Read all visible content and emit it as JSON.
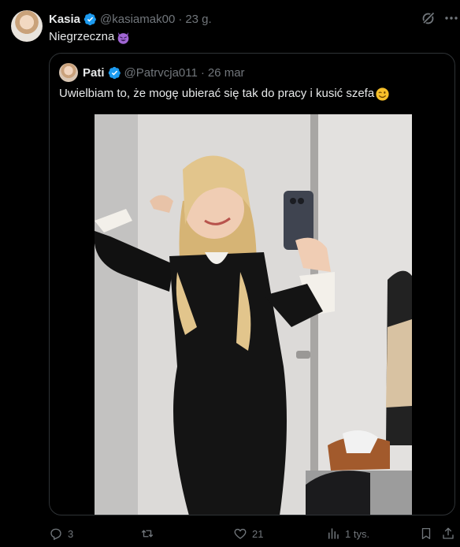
{
  "tweet": {
    "author_name": "Kasia",
    "author_handle": "@kasiamak00",
    "separator": "·",
    "time": "23 g.",
    "text": "Niegrzeczna",
    "text_emoji": "smiling-devil-emoji"
  },
  "quoted": {
    "author_name": "Pati",
    "author_handle": "@Patrvcja011",
    "separator": "·",
    "time": "26 mar",
    "text": "Uwielbiam to, że mogę ubierać się tak do pracy i kusić szefa",
    "text_emoji": "winking-face-emoji"
  },
  "actions": {
    "replies": "3",
    "retweets": "",
    "likes": "21",
    "views": "1 tys."
  },
  "colors": {
    "background": "#000000",
    "text": "#e7e9ea",
    "secondary": "#71767b",
    "verified": "#1d9bf0",
    "border": "#2f3336"
  }
}
